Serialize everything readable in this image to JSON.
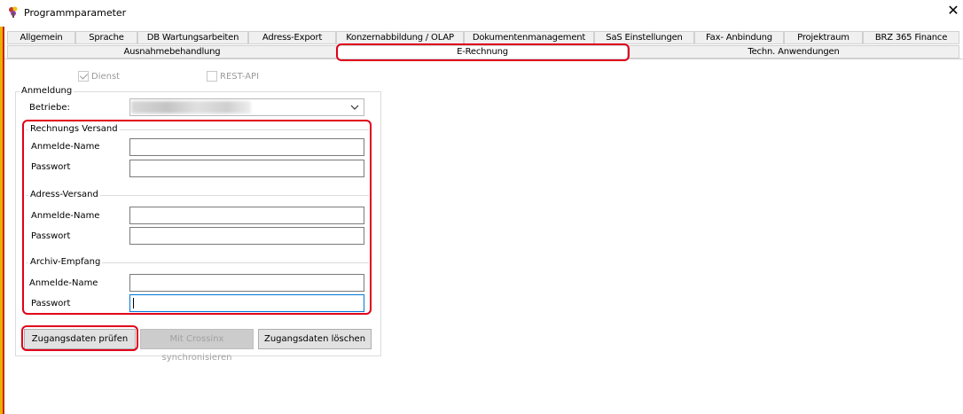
{
  "window": {
    "title": "Programmparameter",
    "close_glyph": "✕"
  },
  "tabs_row1": [
    {
      "label": "Allgemein"
    },
    {
      "label": "Sprache"
    },
    {
      "label": "DB Wartungsarbeiten"
    },
    {
      "label": "Adress-Export"
    },
    {
      "label": "Konzernabbildung / OLAP"
    },
    {
      "label": "Dokumentenmanagement"
    },
    {
      "label": "SaS Einstellungen"
    },
    {
      "label": "Fax- Anbindung"
    },
    {
      "label": "Projektraum"
    },
    {
      "label": "BRZ 365 Finance"
    }
  ],
  "tabs_row2": [
    {
      "label": "Ausnahmebehandlung"
    },
    {
      "label": "E-Rechnung",
      "active": true
    },
    {
      "label": "Techn. Anwendungen"
    }
  ],
  "options": {
    "dienst": {
      "label": "Dienst",
      "checked": true,
      "enabled": false
    },
    "rest_api": {
      "label": "REST-API",
      "checked": false,
      "enabled": false
    }
  },
  "anmeldung": {
    "group_label": "Anmeldung",
    "betriebe_label": "Betriebe:",
    "betriebe_value": ""
  },
  "rechnungs_versand": {
    "group_label": "Rechnungs Versand",
    "name_label": "Anmelde-Name",
    "name_value": "",
    "password_label": "Passwort",
    "password_value": ""
  },
  "adress_versand": {
    "group_label": "Adress-Versand",
    "name_label": "Anmelde-Name",
    "name_value": "",
    "password_label": "Passwort",
    "password_value": ""
  },
  "archiv_empfang": {
    "group_label": "Archiv-Empfang",
    "name_label": "Anmelde-Name",
    "name_value": "",
    "password_label": "Passwort",
    "password_value": ""
  },
  "buttons": {
    "check": "Zugangsdaten prüfen",
    "sync": "Mit Crossinx synchronisieren",
    "delete": "Zugangsdaten löschen"
  },
  "colors": {
    "highlight": "#e0001a",
    "focus": "#0078d7"
  }
}
